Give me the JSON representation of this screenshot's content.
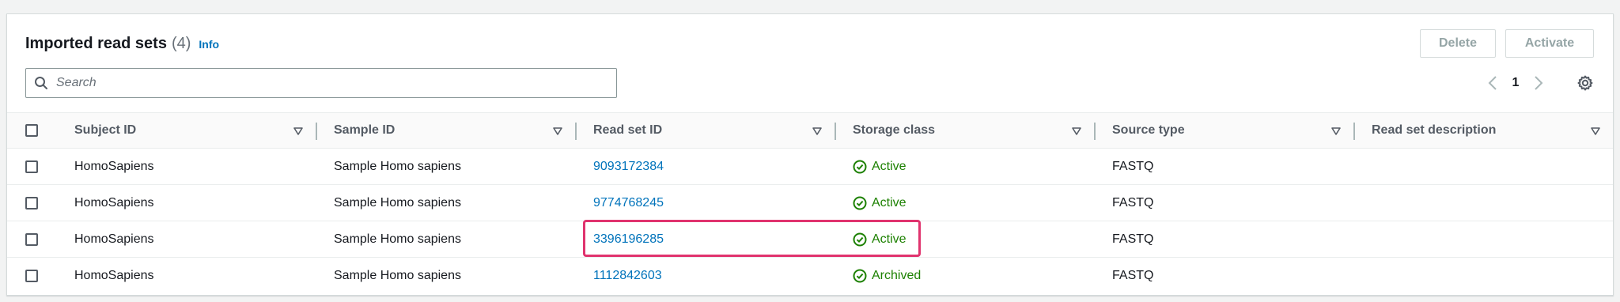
{
  "header": {
    "title": "Imported read sets",
    "count": "(4)",
    "info": "Info",
    "delete_label": "Delete",
    "activate_label": "Activate"
  },
  "search": {
    "placeholder": "Search"
  },
  "pagination": {
    "current_page": "1"
  },
  "columns": [
    "Subject ID",
    "Sample ID",
    "Read set ID",
    "Storage class",
    "Source type",
    "Read set description"
  ],
  "rows": [
    {
      "subject_id": "HomoSapiens",
      "sample_id": "Sample Homo sapiens",
      "read_set_id": "9093172384",
      "storage_class": "Active",
      "source_type": "FASTQ",
      "description": ""
    },
    {
      "subject_id": "HomoSapiens",
      "sample_id": "Sample Homo sapiens",
      "read_set_id": "9774768245",
      "storage_class": "Active",
      "source_type": "FASTQ",
      "description": ""
    },
    {
      "subject_id": "HomoSapiens",
      "sample_id": "Sample Homo sapiens",
      "read_set_id": "3396196285",
      "storage_class": "Active",
      "source_type": "FASTQ",
      "description": ""
    },
    {
      "subject_id": "HomoSapiens",
      "sample_id": "Sample Homo sapiens",
      "read_set_id": "1112842603",
      "storage_class": "Archived",
      "source_type": "FASTQ",
      "description": ""
    }
  ],
  "colors": {
    "link": "#0073bb",
    "success": "#1d8102",
    "highlight": "#e0336e"
  },
  "icons": {
    "search": "search-icon",
    "sort": "caret-down-icon",
    "status": "check-circle-icon",
    "settings": "gear-icon",
    "prev": "chevron-left-icon",
    "next": "chevron-right-icon"
  }
}
